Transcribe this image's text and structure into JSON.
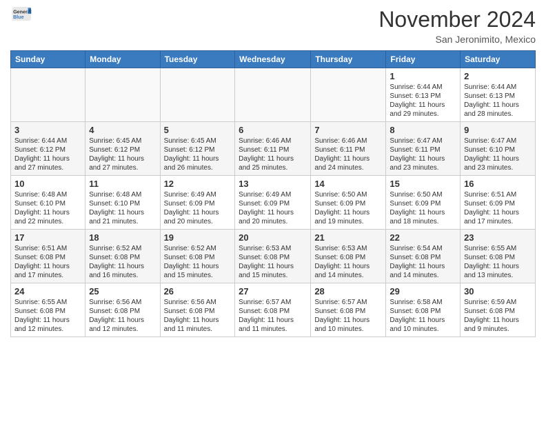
{
  "header": {
    "logo": {
      "general": "General",
      "blue": "Blue"
    },
    "title": "November 2024",
    "location": "San Jeronimito, Mexico"
  },
  "calendar": {
    "days_of_week": [
      "Sunday",
      "Monday",
      "Tuesday",
      "Wednesday",
      "Thursday",
      "Friday",
      "Saturday"
    ],
    "weeks": [
      {
        "days": [
          {
            "number": "",
            "info": ""
          },
          {
            "number": "",
            "info": ""
          },
          {
            "number": "",
            "info": ""
          },
          {
            "number": "",
            "info": ""
          },
          {
            "number": "",
            "info": ""
          },
          {
            "number": "1",
            "info": "Sunrise: 6:44 AM\nSunset: 6:13 PM\nDaylight: 11 hours and 29 minutes."
          },
          {
            "number": "2",
            "info": "Sunrise: 6:44 AM\nSunset: 6:13 PM\nDaylight: 11 hours and 28 minutes."
          }
        ]
      },
      {
        "days": [
          {
            "number": "3",
            "info": "Sunrise: 6:44 AM\nSunset: 6:12 PM\nDaylight: 11 hours and 27 minutes."
          },
          {
            "number": "4",
            "info": "Sunrise: 6:45 AM\nSunset: 6:12 PM\nDaylight: 11 hours and 27 minutes."
          },
          {
            "number": "5",
            "info": "Sunrise: 6:45 AM\nSunset: 6:12 PM\nDaylight: 11 hours and 26 minutes."
          },
          {
            "number": "6",
            "info": "Sunrise: 6:46 AM\nSunset: 6:11 PM\nDaylight: 11 hours and 25 minutes."
          },
          {
            "number": "7",
            "info": "Sunrise: 6:46 AM\nSunset: 6:11 PM\nDaylight: 11 hours and 24 minutes."
          },
          {
            "number": "8",
            "info": "Sunrise: 6:47 AM\nSunset: 6:11 PM\nDaylight: 11 hours and 23 minutes."
          },
          {
            "number": "9",
            "info": "Sunrise: 6:47 AM\nSunset: 6:10 PM\nDaylight: 11 hours and 23 minutes."
          }
        ]
      },
      {
        "days": [
          {
            "number": "10",
            "info": "Sunrise: 6:48 AM\nSunset: 6:10 PM\nDaylight: 11 hours and 22 minutes."
          },
          {
            "number": "11",
            "info": "Sunrise: 6:48 AM\nSunset: 6:10 PM\nDaylight: 11 hours and 21 minutes."
          },
          {
            "number": "12",
            "info": "Sunrise: 6:49 AM\nSunset: 6:09 PM\nDaylight: 11 hours and 20 minutes."
          },
          {
            "number": "13",
            "info": "Sunrise: 6:49 AM\nSunset: 6:09 PM\nDaylight: 11 hours and 20 minutes."
          },
          {
            "number": "14",
            "info": "Sunrise: 6:50 AM\nSunset: 6:09 PM\nDaylight: 11 hours and 19 minutes."
          },
          {
            "number": "15",
            "info": "Sunrise: 6:50 AM\nSunset: 6:09 PM\nDaylight: 11 hours and 18 minutes."
          },
          {
            "number": "16",
            "info": "Sunrise: 6:51 AM\nSunset: 6:09 PM\nDaylight: 11 hours and 17 minutes."
          }
        ]
      },
      {
        "days": [
          {
            "number": "17",
            "info": "Sunrise: 6:51 AM\nSunset: 6:08 PM\nDaylight: 11 hours and 17 minutes."
          },
          {
            "number": "18",
            "info": "Sunrise: 6:52 AM\nSunset: 6:08 PM\nDaylight: 11 hours and 16 minutes."
          },
          {
            "number": "19",
            "info": "Sunrise: 6:52 AM\nSunset: 6:08 PM\nDaylight: 11 hours and 15 minutes."
          },
          {
            "number": "20",
            "info": "Sunrise: 6:53 AM\nSunset: 6:08 PM\nDaylight: 11 hours and 15 minutes."
          },
          {
            "number": "21",
            "info": "Sunrise: 6:53 AM\nSunset: 6:08 PM\nDaylight: 11 hours and 14 minutes."
          },
          {
            "number": "22",
            "info": "Sunrise: 6:54 AM\nSunset: 6:08 PM\nDaylight: 11 hours and 14 minutes."
          },
          {
            "number": "23",
            "info": "Sunrise: 6:55 AM\nSunset: 6:08 PM\nDaylight: 11 hours and 13 minutes."
          }
        ]
      },
      {
        "days": [
          {
            "number": "24",
            "info": "Sunrise: 6:55 AM\nSunset: 6:08 PM\nDaylight: 11 hours and 12 minutes."
          },
          {
            "number": "25",
            "info": "Sunrise: 6:56 AM\nSunset: 6:08 PM\nDaylight: 11 hours and 12 minutes."
          },
          {
            "number": "26",
            "info": "Sunrise: 6:56 AM\nSunset: 6:08 PM\nDaylight: 11 hours and 11 minutes."
          },
          {
            "number": "27",
            "info": "Sunrise: 6:57 AM\nSunset: 6:08 PM\nDaylight: 11 hours and 11 minutes."
          },
          {
            "number": "28",
            "info": "Sunrise: 6:57 AM\nSunset: 6:08 PM\nDaylight: 11 hours and 10 minutes."
          },
          {
            "number": "29",
            "info": "Sunrise: 6:58 AM\nSunset: 6:08 PM\nDaylight: 11 hours and 10 minutes."
          },
          {
            "number": "30",
            "info": "Sunrise: 6:59 AM\nSunset: 6:08 PM\nDaylight: 11 hours and 9 minutes."
          }
        ]
      }
    ]
  }
}
